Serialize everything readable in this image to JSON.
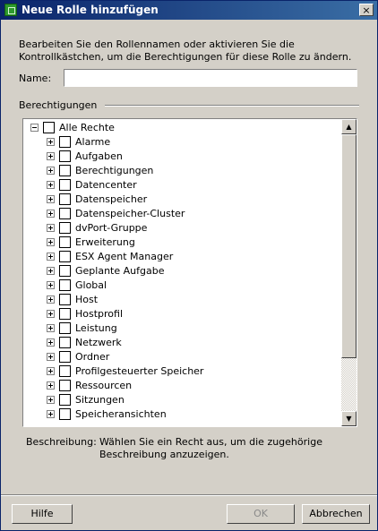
{
  "window": {
    "title": "Neue Rolle hinzufügen",
    "close_glyph": "×"
  },
  "intro_text": "Bearbeiten Sie den Rollennamen oder aktivieren Sie die Kontrollkästchen, um die Berechtigungen für diese Rolle zu ändern.",
  "name_field": {
    "label": "Name:",
    "value": ""
  },
  "permissions": {
    "title": "Berechtigungen",
    "root": {
      "label": "Alle Rechte",
      "expanded": true,
      "checked": false
    },
    "items": [
      "Alarme",
      "Aufgaben",
      "Berechtigungen",
      "Datencenter",
      "Datenspeicher",
      "Datenspeicher-Cluster",
      "dvPort-Gruppe",
      "Erweiterung",
      "ESX Agent Manager",
      "Geplante Aufgabe",
      "Global",
      "Host",
      "Hostprofil",
      "Leistung",
      "Netzwerk",
      "Ordner",
      "Profilgesteuerter Speicher",
      "Ressourcen",
      "Sitzungen",
      "Speicheransichten"
    ]
  },
  "description": {
    "label": "Beschreibung:",
    "text": "Wählen Sie ein Recht aus, um die zugehörige Beschreibung anzuzeigen."
  },
  "buttons": {
    "help": "Hilfe",
    "ok": "OK",
    "cancel": "Abbrechen"
  },
  "scroll_glyphs": {
    "up": "▲",
    "down": "▼"
  },
  "colors": {
    "titlebar_start": "#0a246a",
    "titlebar_end": "#3a6ea5",
    "dialog_bg": "#d4d0c8"
  }
}
